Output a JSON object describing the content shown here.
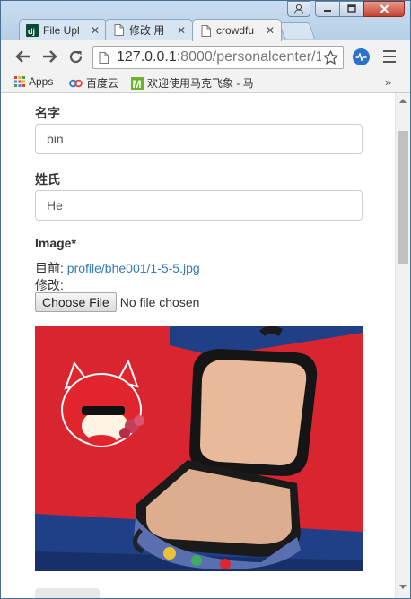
{
  "browser": {
    "tabs": [
      {
        "title": "File Upl",
        "icon": "django-icon",
        "active": false
      },
      {
        "title": "修改 用",
        "icon": "page-icon",
        "active": false
      },
      {
        "title": "crowdfu",
        "icon": "page-icon",
        "active": true
      }
    ],
    "url_host": "127.0.0.1",
    "url_rest": ":8000/personalcenter/1/",
    "bookmarks": [
      {
        "label": "Apps",
        "icon": "apps-grid-icon"
      },
      {
        "label": "百度云",
        "icon": "baidu-cloud-icon"
      },
      {
        "label": "欢迎使用马克飞象 - 马",
        "icon": "maxiang-icon"
      }
    ],
    "more_bookmarks": "»",
    "colors": {
      "close_button": "#c6432f",
      "frame": "#b9d3ea",
      "extension": "#2a73c9"
    }
  },
  "form": {
    "first_name": {
      "label": "名字",
      "value": "bin"
    },
    "last_name": {
      "label": "姓氏",
      "value": "He"
    },
    "image": {
      "label": "Image*",
      "current_prefix": "目前:",
      "current_link": "profile/bhe001/1-5-5.jpg",
      "change_label": "修改:",
      "choose_button": "Choose File",
      "no_file": "No file chosen"
    }
  },
  "colors": {
    "link": "#337ab7",
    "photo_bg": "#d9252f",
    "photo_accent": "#1f3f87"
  }
}
